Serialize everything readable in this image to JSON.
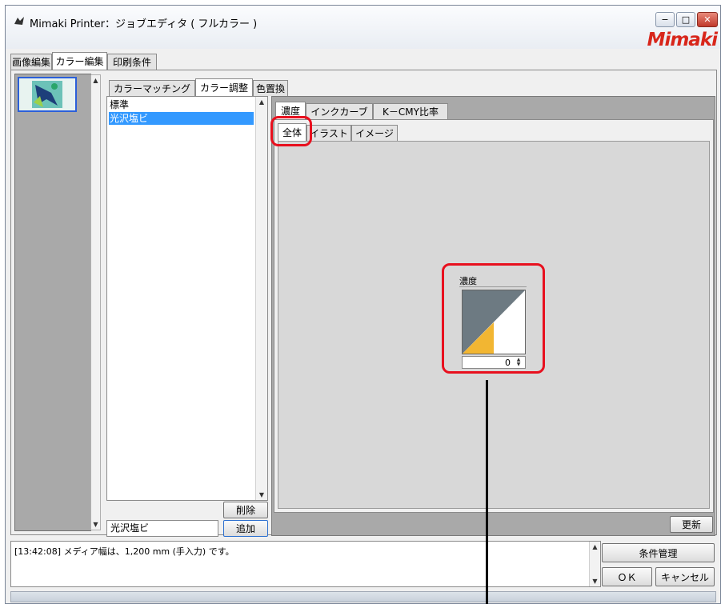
{
  "window": {
    "title": "Mimaki Printer：ジョブエディタ ( フルカラー )",
    "logo": "Mimaki",
    "controls": {
      "minimize": "−",
      "maximize": "□",
      "close": "✕"
    }
  },
  "main_tabs": [
    "画像編集",
    "カラー編集",
    "印刷条件"
  ],
  "sub_tabs": [
    "カラーマッチング",
    "カラー調整",
    "色置換"
  ],
  "profile_list": {
    "items": [
      "標準",
      "光沢塩ビ"
    ],
    "selected_index": 1,
    "name_input": "光沢塩ビ",
    "delete_label": "削除",
    "add_label": "追加"
  },
  "adjust_tabs": [
    "濃度",
    "インクカーブ",
    "K－CMY比率"
  ],
  "range_tabs": [
    "全体",
    "イラスト",
    "イメージ"
  ],
  "density": {
    "label": "濃度",
    "value": "0"
  },
  "update_label": "更新",
  "log": {
    "message": "[13:42:08] メディア幅は、1,200 mm (手入力) です。"
  },
  "buttons": {
    "conditions": "条件管理",
    "ok": "ＯＫ",
    "cancel": "キャンセル"
  },
  "colors": {
    "accent": "#3399ff",
    "highlight": "#e8101e",
    "logo": "#d8261c",
    "curve_fill": "#f2b632"
  }
}
